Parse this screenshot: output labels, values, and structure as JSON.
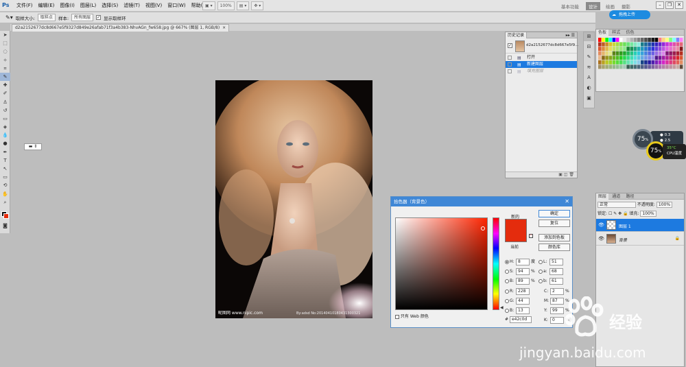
{
  "app": {
    "logo": "Ps"
  },
  "menu": [
    "文件(F)",
    "编辑(E)",
    "图像(I)",
    "图层(L)",
    "选择(S)",
    "滤镜(T)",
    "视图(V)",
    "窗口(W)",
    "帮助(H)"
  ],
  "menubar_tools": {
    "zoom": "100%"
  },
  "workspaces": [
    "基本功能",
    "设计",
    "绘画",
    "摄影"
  ],
  "workspace_active": "设计",
  "cloud_button": "拖拽上传",
  "options": {
    "sample_size_label": "取样大小:",
    "sample_size_value": "取样点",
    "sample_label": "样本:",
    "sample_value": "所有图层",
    "show_ring_label": "显示取样环"
  },
  "document_tab": "d2a2152677dc8d667e5f9327d849e26afab71f3a4b383-NhvAGn_fw658.jpg @ 667% (图层 1, RGB/8)",
  "photo": {
    "watermark_left": "昵图网 www.nipic.com",
    "watermark_right": "By:adsd  No:20140410180431300321"
  },
  "history": {
    "tab": "历史记录",
    "snapshot_name": "d2a2152677dc8d667e5f9...",
    "items": [
      {
        "label": "打开",
        "state": "normal"
      },
      {
        "label": "新建图层",
        "state": "selected"
      },
      {
        "label": "填充图层",
        "state": "dim"
      }
    ]
  },
  "color_panel": {
    "tabs": [
      "色板",
      "样式",
      "仿色"
    ]
  },
  "layers": {
    "tabs": [
      "图层",
      "通道",
      "路径"
    ],
    "blend_mode": "正常",
    "opacity_label": "不透明度:",
    "opacity_value": "100%",
    "lock_label": "锁定:",
    "fill_label": "填充:",
    "fill_value": "100%",
    "items": [
      {
        "name": "图层 1",
        "selected": true,
        "thumb": "transparent"
      },
      {
        "name": "背景",
        "selected": false,
        "thumb": "photo"
      }
    ]
  },
  "cpu_widget": {
    "usage1": "75",
    "usage2": "75",
    "stat_a": "0.3",
    "stat_b": "2.5",
    "temp": "35°C",
    "temp_label": "CPU温度"
  },
  "picker": {
    "title": "拾色器（背景色）",
    "new_label": "新的",
    "current_label": "当前",
    "new_color": "#e42c0d",
    "current_color": "#e42c0d",
    "sv": {
      "saturation": 0.94,
      "brightness": 0.89
    },
    "hue_deg": 8,
    "buttons": {
      "ok": "确定",
      "cancel": "复位",
      "add_swatch": "添加到色板",
      "libraries": "颜色库"
    },
    "fields": {
      "H": "8",
      "S": "94",
      "B": "89",
      "R": "228",
      "G": "44",
      "Bl": "13",
      "L": "51",
      "a": "68",
      "b": "61",
      "C": "2",
      "M": "87",
      "Y": "99",
      "K": "0"
    },
    "units": {
      "deg": "度",
      "pct": "%"
    },
    "field_labels": {
      "H": "H:",
      "S": "S:",
      "B": "B:",
      "R": "R:",
      "G": "G:",
      "Bl": "B:",
      "L": "L:",
      "a": "a:",
      "b": "b:",
      "C": "C:",
      "M": "M:",
      "Y": "Y:",
      "K": "K:"
    },
    "web_only_label": "只有 Web 颜色",
    "hex_label": "#",
    "hex_value": "e42c0d"
  },
  "watermark": {
    "text": "经验",
    "url": "jingyan.baidu.com"
  }
}
